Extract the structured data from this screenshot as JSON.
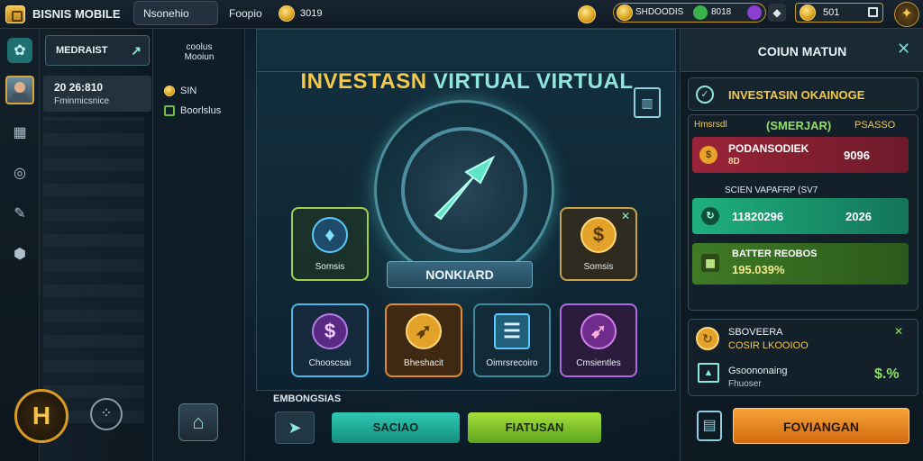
{
  "topbar": {
    "app_title": "BISNIS MOBILE",
    "tab_1": "Nsonehio",
    "tab_2": "Foopio",
    "gold_amount": "3019",
    "resources_label": "SHDOODIS",
    "resource_green": "8018",
    "resource_gold": "501"
  },
  "left_panel": {
    "market_button": "MEDRAIST",
    "player_level": "20 26:810",
    "player_subtitle": "Fminmicsnice",
    "section_title_line1": "coolus",
    "section_title_line2": "Mooiun",
    "item_1": "SIN",
    "item_2": "Boorlslus"
  },
  "center": {
    "title_word_1": "INVESTASN",
    "title_word_2": "VIRTUAL VIRTUAL",
    "main_button": "NONKIARD",
    "tiles": [
      "Somsis",
      "Somsis",
      "Chooscsai",
      "Bheshacit",
      "Oimrsrecoiro",
      "Cmsientles"
    ],
    "bottom_section_label": "EMBONGSIAS",
    "btn_teal": "SACIAO",
    "btn_green": "FIATUSAN"
  },
  "right_panel": {
    "header": "COIUN MATUN",
    "sub_header": "INVESTASIN OKAINOGE",
    "col_1": "Hmsrsdl",
    "col_2": "(SMERJAR)",
    "col_3": "PSASSO",
    "row_red_label": "PODANSODIEK",
    "row_red_sub": "8D",
    "row_red_value": "9096",
    "row_teal_caption": "SCIEN VAPAFRP (SV7",
    "row_teal_label": "11820296",
    "row_teal_value": "2026",
    "row_green_label": "BATTER REOBOS",
    "row_green_value": "195.039%",
    "card_line_1": "SBOVEERA",
    "card_line_2": "COSIR LKOOIOO",
    "card_line_3": "Gsoononaing",
    "card_line_4": "Fhuoser",
    "card_value": "$.%",
    "action_button": "FOVIANGAN"
  },
  "colors": {
    "gold": "#f4c94b",
    "teal": "#1fb8a4",
    "green": "#7fcb2c",
    "red": "#9a2338",
    "orange": "#f08a1c"
  },
  "icons": [
    "app-logo-icon",
    "coin-icon",
    "dashboard-icon",
    "chart-icon",
    "shield-icon",
    "pen-icon",
    "cube-icon",
    "home-icon",
    "arrow-icon",
    "close-icon",
    "bulb-icon",
    "dollar-icon",
    "rocket-icon",
    "document-icon",
    "calculator-icon",
    "building-icon"
  ]
}
